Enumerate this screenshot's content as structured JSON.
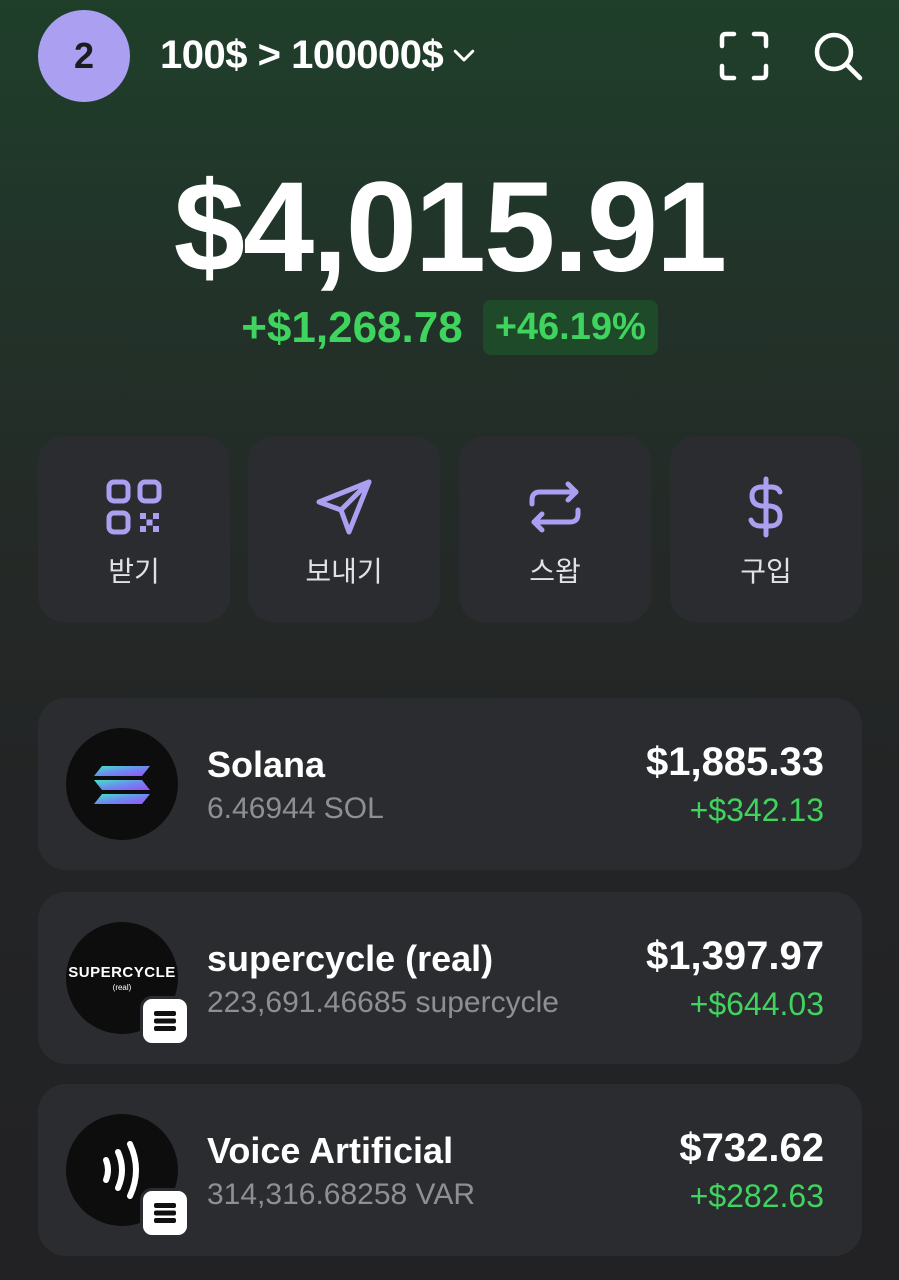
{
  "header": {
    "avatar_label": "2",
    "account_name": "100$ > 100000$",
    "icons": [
      "chevron-down-icon",
      "scan-icon",
      "search-icon"
    ]
  },
  "portfolio": {
    "balance": "$4,015.91",
    "change_amount": "+$1,268.78",
    "change_percent": "+46.19%"
  },
  "actions": [
    {
      "label": "받기",
      "icon": "qr-code-icon"
    },
    {
      "label": "보내기",
      "icon": "send-icon"
    },
    {
      "label": "스왑",
      "icon": "swap-icon"
    },
    {
      "label": "구입",
      "icon": "dollar-icon"
    }
  ],
  "tokens": [
    {
      "name": "Solana",
      "amount": "6.46944 SOL",
      "value": "$1,885.33",
      "gain": "+$342.13",
      "logo": "solana-logo"
    },
    {
      "name": "supercycle (real)",
      "amount": "223,691.46685 supercycle",
      "value": "$1,397.97",
      "gain": "+$644.03",
      "logo": "supercycle-logo",
      "logo_text": "SUPERCYCLE",
      "logo_subtext": "(real)"
    },
    {
      "name": "Voice Artificial",
      "amount": "314,316.68258 VAR",
      "value": "$732.62",
      "gain": "+$282.63",
      "logo": "voice-wave-logo"
    }
  ],
  "colors": {
    "accent_purple": "#ab9ff2",
    "positive_green": "#3fd45d",
    "card_bg": "#2b2c30"
  }
}
